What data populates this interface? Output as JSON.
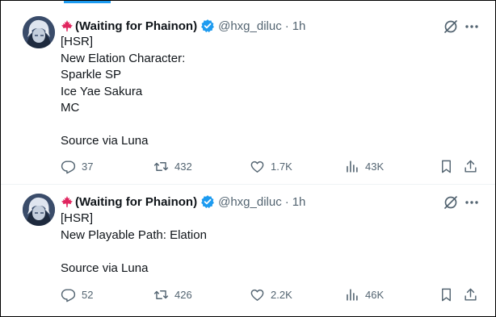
{
  "tweets": [
    {
      "author": {
        "display_name": "(Waiting for Phainon)",
        "handle": "@hxg_diluc",
        "verified": true
      },
      "separator": "·",
      "time": "1h",
      "lines": [
        "[HSR]",
        "New Elation Character:",
        "Sparkle SP",
        "Ice Yae Sakura",
        "MC",
        "",
        "Source via Luna"
      ],
      "actions": {
        "replies": "37",
        "reposts": "432",
        "likes": "1.7K",
        "views": "43K"
      }
    },
    {
      "author": {
        "display_name": "(Waiting for Phainon)",
        "handle": "@hxg_diluc",
        "verified": true
      },
      "separator": "·",
      "time": "1h",
      "lines": [
        "[HSR]",
        "New Playable Path: Elation",
        "",
        "Source via Luna"
      ],
      "actions": {
        "replies": "52",
        "reposts": "426",
        "likes": "2.2K",
        "views": "46K"
      }
    }
  ],
  "colors": {
    "accent": "#1d9bf0",
    "muted": "#536471",
    "text": "#0f1419",
    "maple_leaf": "#e0245e",
    "avatar_bg": "#3a4c6a"
  },
  "icons": [
    "maple-leaf-icon",
    "verified-badge-icon",
    "grok-icon",
    "more-icon",
    "reply-icon",
    "repost-icon",
    "like-icon",
    "views-icon",
    "bookmark-icon",
    "share-icon"
  ]
}
